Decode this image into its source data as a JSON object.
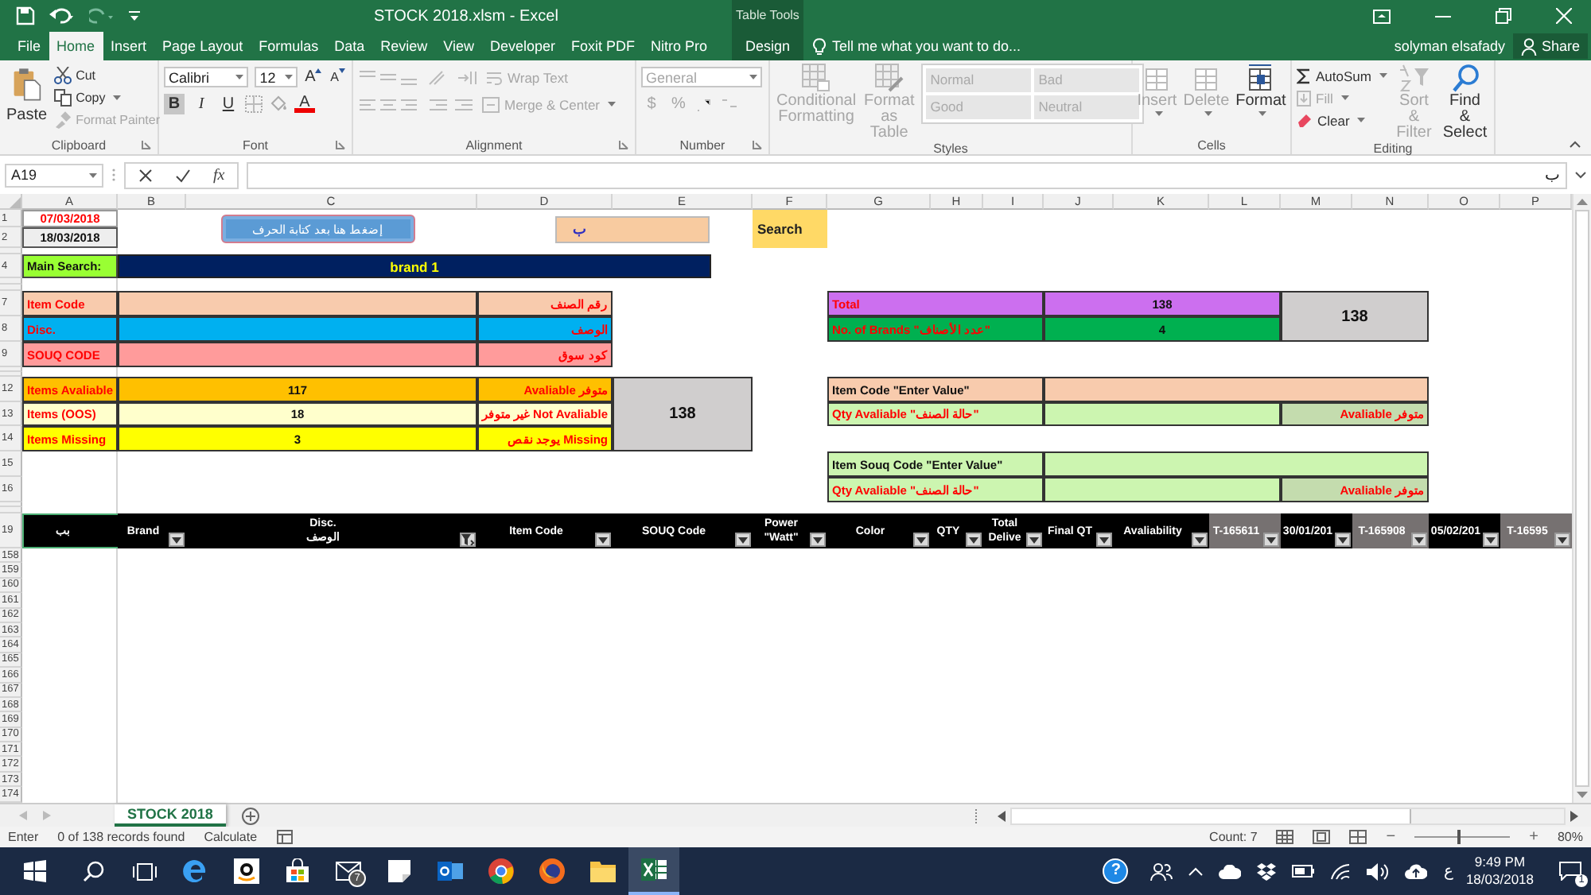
{
  "window": {
    "title": "STOCK 2018.xlsm - Excel",
    "context": "Table Tools",
    "user": "solyman elsafady",
    "share": "Share"
  },
  "tabs": [
    {
      "label": "File",
      "selected": false
    },
    {
      "label": "Home",
      "selected": true
    },
    {
      "label": "Insert",
      "selected": false
    },
    {
      "label": "Page Layout",
      "selected": false
    },
    {
      "label": "Formulas",
      "selected": false
    },
    {
      "label": "Data",
      "selected": false
    },
    {
      "label": "Review",
      "selected": false
    },
    {
      "label": "View",
      "selected": false
    },
    {
      "label": "Developer",
      "selected": false
    },
    {
      "label": "Foxit PDF",
      "selected": false
    },
    {
      "label": "Nitro Pro",
      "selected": false
    }
  ],
  "context_tab": {
    "label": "Design",
    "selected": false
  },
  "tell_me": "Tell me what you want to do...",
  "clipboard": {
    "label": "Clipboard",
    "paste": {
      "label": "Paste",
      "disabled": false
    },
    "cut": {
      "label": "Cut",
      "disabled": false
    },
    "copy": {
      "label": "Copy",
      "disabled": false
    },
    "painter": {
      "label": "Format Painter",
      "disabled": true
    }
  },
  "font": {
    "label": "Font",
    "name": "Calibri",
    "size": "12",
    "grow": "A",
    "shrink": "A",
    "bold": {
      "label": "B",
      "on": true
    },
    "italic": {
      "label": "I",
      "on": false
    },
    "underline": {
      "label": "U",
      "on": false
    },
    "color_button": "A"
  },
  "alignment": {
    "label": "Alignment",
    "wrap": {
      "label": "Wrap Text",
      "disabled": true
    },
    "merge": {
      "label": "Merge & Center",
      "disabled": true
    }
  },
  "number": {
    "label": "Number",
    "format": {
      "label": "General",
      "disabled": true
    },
    "currency": "$",
    "percent": "%"
  },
  "styles": {
    "label": "Styles",
    "conditional": {
      "label": "Conditional\nFormatting",
      "disabled": true
    },
    "as_table": {
      "label": "Format as\nTable",
      "disabled": true
    },
    "gallery": [
      "Normal",
      "Bad",
      "Good",
      "Neutral"
    ]
  },
  "cells": {
    "label": "Cells",
    "items": [
      {
        "label": "Insert",
        "disabled": true
      },
      {
        "label": "Delete",
        "disabled": true
      },
      {
        "label": "Format",
        "disabled": false
      }
    ]
  },
  "editing": {
    "label": "Editing",
    "autosum": {
      "label": "AutoSum",
      "disabled": false
    },
    "fill": {
      "label": "Fill",
      "disabled": true
    },
    "clear": {
      "label": "Clear",
      "disabled": false
    },
    "sort": {
      "label": "Sort &\nFilter",
      "disabled": true
    },
    "find": {
      "label": "Find &\nSelect",
      "disabled": false
    }
  },
  "formula_bar": {
    "name_box": "A19",
    "fx": "fx",
    "value": "ب"
  },
  "sheet": {
    "columns": [
      "A",
      "B",
      "C",
      "D",
      "E",
      "F",
      "G",
      "H",
      "I",
      "J",
      "K",
      "L",
      "M",
      "N",
      "O",
      "P"
    ],
    "row_numbers": [
      "1",
      "2",
      "4",
      "7",
      "8",
      "9",
      "12",
      "13",
      "14",
      "15",
      "16",
      "19",
      "158",
      "159",
      "160",
      "161",
      "162",
      "163",
      "164",
      "165",
      "166",
      "167",
      "168",
      "169",
      "170",
      "171",
      "172",
      "173",
      "174"
    ],
    "dates": [
      "07/03/2018",
      "18/03/2018"
    ],
    "macro_button": "إضغط هنا بعد كتابة الحرف",
    "search_value": "ب",
    "search_button": "Search",
    "main_search": {
      "label": "Main Search:",
      "value": "brand 1"
    },
    "detail_rows": [
      {
        "label": "Item Code",
        "arabic": "رقم الصنف",
        "color": "#f8cbad"
      },
      {
        "label": "Disc.",
        "arabic": "الوصف",
        "color": "#00b0f0"
      },
      {
        "label": "SOUQ CODE",
        "arabic": "كود سوق",
        "color": "#ff9b9b"
      }
    ],
    "stock_rows": [
      {
        "label": "Items Avaliable",
        "value": "117",
        "status": "Avaliable متوفر",
        "color": "#ffc000"
      },
      {
        "label": "Items (OOS)",
        "value": "18",
        "status": "غير متوفر Not Avaliable",
        "color": "#ffffcc"
      },
      {
        "label": "Items Missing",
        "value": "3",
        "status": "يوجد نقص Missing",
        "color": "#ffff00"
      }
    ],
    "stock_total": "138",
    "summary": [
      {
        "label": "Total",
        "value": "138",
        "color": "#cc6fef"
      },
      {
        "label": "No. of Brands \"عدد الأصناف\"",
        "value": "4",
        "color": "#00b050"
      }
    ],
    "summary_total": "138",
    "lookups": [
      {
        "label": "Item Code \"Enter Value\"",
        "color": "#f8cbad",
        "qty_label": "Qty Avaliable \"حالة الصنف\"",
        "status": "Avaliable متوفر"
      },
      {
        "label": "Item Souq Code \"Enter Value\"",
        "color": "#ccf5b0",
        "qty_label": "Qty Avaliable \"حالة الصنف\"",
        "status": "Avaliable متوفر"
      }
    ],
    "header_a": "بب",
    "table_header": [
      {
        "label": "Brand",
        "filtered": false,
        "color": "#000000"
      },
      {
        "label": "Disc.\nالوصف",
        "filtered": true,
        "color": "#000000"
      },
      {
        "label": "Item Code",
        "filtered": false,
        "color": "#000000"
      },
      {
        "label": "SOUQ Code",
        "filtered": false,
        "color": "#000000"
      },
      {
        "label": "Power\n\"Watt\"",
        "filtered": false,
        "color": "#000000"
      },
      {
        "label": "Color",
        "filtered": false,
        "color": "#000000"
      },
      {
        "label": "QTY",
        "filtered": false,
        "color": "#000000"
      },
      {
        "label": "Total\nDelive",
        "filtered": false,
        "color": "#000000"
      },
      {
        "label": "Final QT",
        "filtered": false,
        "color": "#000000"
      },
      {
        "label": "Avaliability",
        "filtered": false,
        "color": "#000000"
      },
      {
        "label": "T-165611",
        "filtered": false,
        "color": "#767171"
      },
      {
        "label": "30/01/201",
        "filtered": false,
        "color": "#000000"
      },
      {
        "label": "T-165908",
        "filtered": false,
        "color": "#767171"
      },
      {
        "label": "05/02/201",
        "filtered": false,
        "color": "#000000"
      },
      {
        "label": "T-16595",
        "filtered": false,
        "color": "#767171"
      }
    ]
  },
  "sheet_tabs": [
    {
      "label": "STOCK 2018",
      "selected": true
    }
  ],
  "status_bar": {
    "mode": "Enter",
    "records": "0 of 138 records found",
    "calculate": "Calculate",
    "count": "Count: 7",
    "zoom_out": "−",
    "zoom_in": "+",
    "zoom": "80%",
    "zoom_slider": {
      "level": 0.47
    }
  },
  "taskbar": {
    "apps": [
      {
        "kind": "search",
        "active": false
      },
      {
        "kind": "taskview",
        "active": false
      },
      {
        "kind": "edge",
        "active": false
      },
      {
        "kind": "amazon",
        "active": false
      },
      {
        "kind": "store",
        "active": false
      },
      {
        "kind": "mail",
        "active": false,
        "badge": "7"
      },
      {
        "kind": "sticky",
        "active": false
      },
      {
        "kind": "outlook",
        "active": false
      },
      {
        "kind": "chrome",
        "active": false
      },
      {
        "kind": "firefox",
        "active": false
      },
      {
        "kind": "explorer",
        "active": false
      },
      {
        "kind": "excel",
        "active": true
      }
    ],
    "help": "?",
    "language": "ع",
    "time": "9:49 PM",
    "date": "18/03/2018",
    "notifications": "1"
  }
}
